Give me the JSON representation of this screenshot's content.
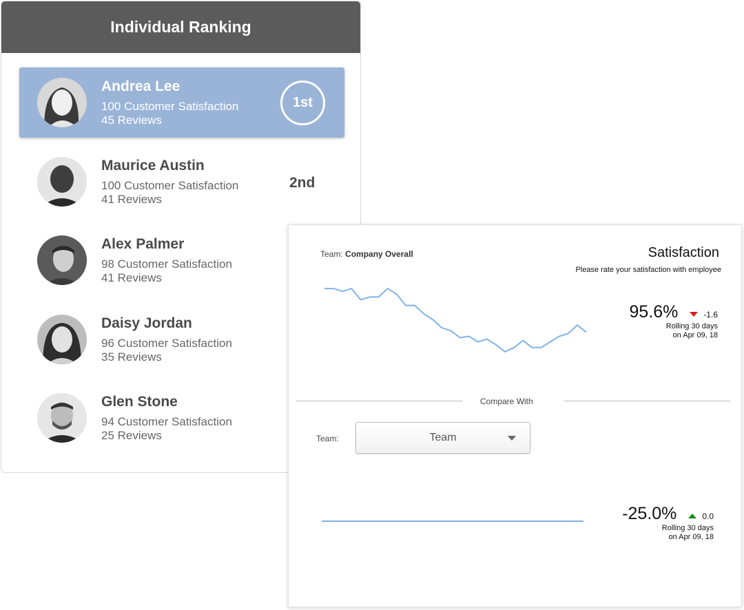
{
  "ranking": {
    "title": "Individual Ranking",
    "people": [
      {
        "name": "Andrea Lee",
        "satisfaction": "100 Customer Satisfaction",
        "reviews": "45 Reviews",
        "rank": "1st",
        "highlight": true
      },
      {
        "name": "Maurice Austin",
        "satisfaction": "100 Customer Satisfaction",
        "reviews": "41 Reviews",
        "rank": "2nd"
      },
      {
        "name": "Alex Palmer",
        "satisfaction": "98 Customer Satisfaction",
        "reviews": "41 Reviews"
      },
      {
        "name": "Daisy Jordan",
        "satisfaction": "96 Customer Satisfaction",
        "reviews": "35 Reviews"
      },
      {
        "name": "Glen Stone",
        "satisfaction": "94 Customer Satisfaction",
        "reviews": "25 Reviews"
      }
    ]
  },
  "satisfaction_panel": {
    "team_label": "Team:",
    "team_value": "Company Overall",
    "title": "Satisfaction",
    "subtitle": "Please rate your satisfaction with employee",
    "primary": {
      "value": "95.6%",
      "delta": "-1.6",
      "delta_direction": "down",
      "delta_color": "#e0191b",
      "note_line1": "Rolling 30 days",
      "note_line2": "on Apr 09, 18"
    },
    "compare_with": "Compare With",
    "select_label": "Team:",
    "select_value": "Team",
    "secondary": {
      "value": "-25.0%",
      "delta": "0.0",
      "delta_direction": "up",
      "delta_color": "#1e8a1e",
      "note_line1": "Rolling 30 days",
      "note_line2": "on Apr 09, 18"
    }
  },
  "chart_data": [
    {
      "type": "line",
      "color": "#7fb3e6",
      "series": [
        {
          "values": [
            98.2,
            98.2,
            98.0,
            98.2,
            97.4,
            97.6,
            97.6,
            98.2,
            97.8,
            97.0,
            97.0,
            96.4,
            96.0,
            95.4,
            95.2,
            94.7,
            94.8,
            94.4,
            94.6,
            94.2,
            93.7,
            94.0,
            94.5,
            94.0,
            94.0,
            94.4,
            94.8,
            95.0,
            95.6,
            95.1
          ]
        }
      ]
    },
    {
      "type": "line",
      "color": "#7fb3e6",
      "series": [
        {
          "values": [
            -25.0,
            -25.0,
            -25.0,
            -25.0,
            -25.0,
            -25.0,
            -25.0,
            -25.0,
            -25.0,
            -25.0,
            -25.0,
            -25.0,
            -25.0,
            -25.0,
            -25.0,
            -25.0,
            -25.0,
            -25.0,
            -25.0,
            -25.0,
            -25.0,
            -25.0,
            -25.0,
            -25.0,
            -25.0,
            -25.0,
            -25.0,
            -25.0,
            -25.0,
            -25.0
          ]
        }
      ]
    }
  ]
}
